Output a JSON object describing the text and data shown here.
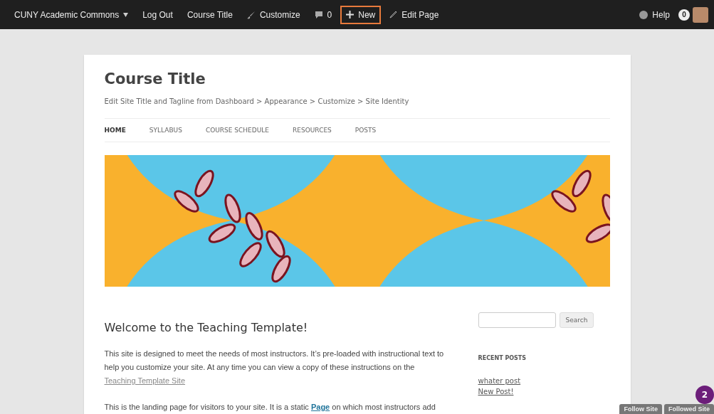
{
  "admin_bar": {
    "items": [
      {
        "kind": "menu",
        "label": "CUNY Academic Commons",
        "highlighted": false
      },
      {
        "kind": "text",
        "label": "Log Out",
        "highlighted": false
      },
      {
        "kind": "text",
        "label": "Course Title",
        "highlighted": false
      },
      {
        "kind": "brush",
        "label": "Customize",
        "highlighted": false
      },
      {
        "kind": "comments",
        "label": "0",
        "highlighted": false
      },
      {
        "kind": "plus",
        "label": "New",
        "highlighted": true
      },
      {
        "kind": "pencil",
        "label": "Edit Page",
        "highlighted": false
      }
    ],
    "right": {
      "help": "Help",
      "count": "0"
    }
  },
  "site": {
    "title": "Course Title",
    "tagline": "Edit Site Title and Tagline from Dashboard > Appearance > Customize > Site Identity"
  },
  "nav": [
    {
      "label": "HOME",
      "selected": true
    },
    {
      "label": "SYLLABUS",
      "selected": false
    },
    {
      "label": "COURSE SCHEDULE",
      "selected": false
    },
    {
      "label": "RESOURCES",
      "selected": false
    },
    {
      "label": "POSTS",
      "selected": false
    }
  ],
  "content": {
    "heading": "Welcome to the Teaching Template!",
    "paragraphs": [
      {
        "text": "This site is designed to meet the needs of most instructors. It’s pre-loaded with instructional text to help you customize your site. At any time you can view a copy of these instructions on the",
        "link": "Teaching Template Site"
      },
      {
        "text": "This is the landing page for visitors to your site. It is a static",
        "link": "Page",
        "after": "on which most instructors add"
      }
    ]
  },
  "sidebar": {
    "search_button": "Search",
    "recent_title": "RECENT POSTS",
    "recent": [
      "whater post",
      "New Post!"
    ]
  },
  "notification_badge": "2",
  "follow_buttons": [
    "Follow Site",
    "Followed Site"
  ]
}
